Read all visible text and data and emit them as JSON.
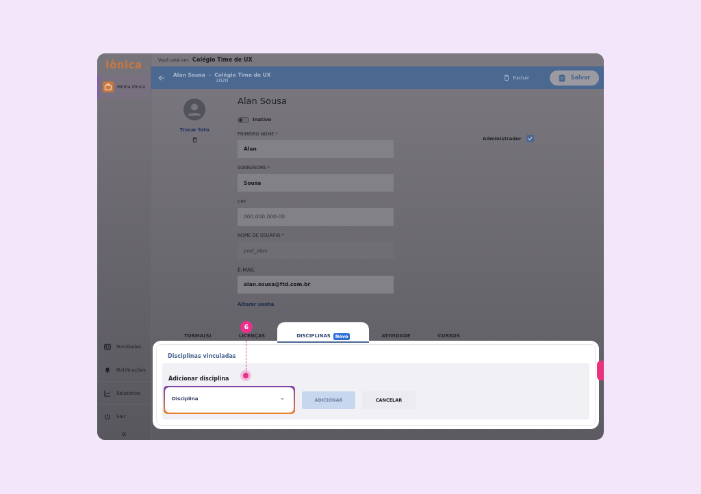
{
  "breadcrumb": {
    "label": "Você está em:",
    "value": "Colégio Time de UX"
  },
  "logo": "iônica",
  "sidebar": {
    "items": [
      {
        "label": "Minha iônica",
        "selected": true
      }
    ],
    "bottom_items": [
      {
        "label": "Novidades",
        "kind": "news"
      },
      {
        "label": "Notificações",
        "kind": "bell"
      },
      {
        "label": "Relatórios",
        "kind": "chart"
      },
      {
        "label": "Sair",
        "kind": "power"
      }
    ],
    "collapse": "«"
  },
  "header": {
    "title": "Alan Sousa  -  Colégio Time de UX",
    "subtitle": "2020",
    "delete": "Excluir",
    "save": "Salvar"
  },
  "profile": {
    "name": "Alan Sousa",
    "change_photo": "Trocar foto",
    "status": {
      "label": "Inativo",
      "on": false
    },
    "admin": {
      "label": "Administrador",
      "checked": true
    },
    "fields": [
      {
        "label": "PRIMEIRO NOME *",
        "value": "Alan",
        "disabled": false
      },
      {
        "label": "SOBRENOME *",
        "value": "Sousa",
        "disabled": false
      },
      {
        "label": "CPF",
        "placeholder": "000.000.000-00",
        "disabled": false
      },
      {
        "label": "NOME DE USUÁRIO *",
        "value": "prof_alan",
        "disabled": true
      },
      {
        "label": "E-MAIL",
        "value": "alan.sousa@ftd.com.br",
        "disabled": false
      }
    ],
    "change_password": "Alterar senha"
  },
  "tabs": [
    {
      "label": "TURMA(S)",
      "selected": false
    },
    {
      "label": "LICENÇAS",
      "selected": false
    },
    {
      "label": "DISCIPLINAS",
      "selected": true,
      "badge": "Novo"
    },
    {
      "label": "ATIVIDADE",
      "selected": false
    },
    {
      "label": "CURSOS",
      "selected": false
    }
  ],
  "panel": {
    "title": "Disciplinas vinculadas",
    "add": {
      "title": "Adicionar disciplina",
      "select": {
        "value": "Disciplina"
      },
      "add_button": {
        "label": "ADICIONAR",
        "disabled": true
      },
      "cancel": "CANCELAR"
    }
  },
  "annotation": {
    "number": "6"
  }
}
